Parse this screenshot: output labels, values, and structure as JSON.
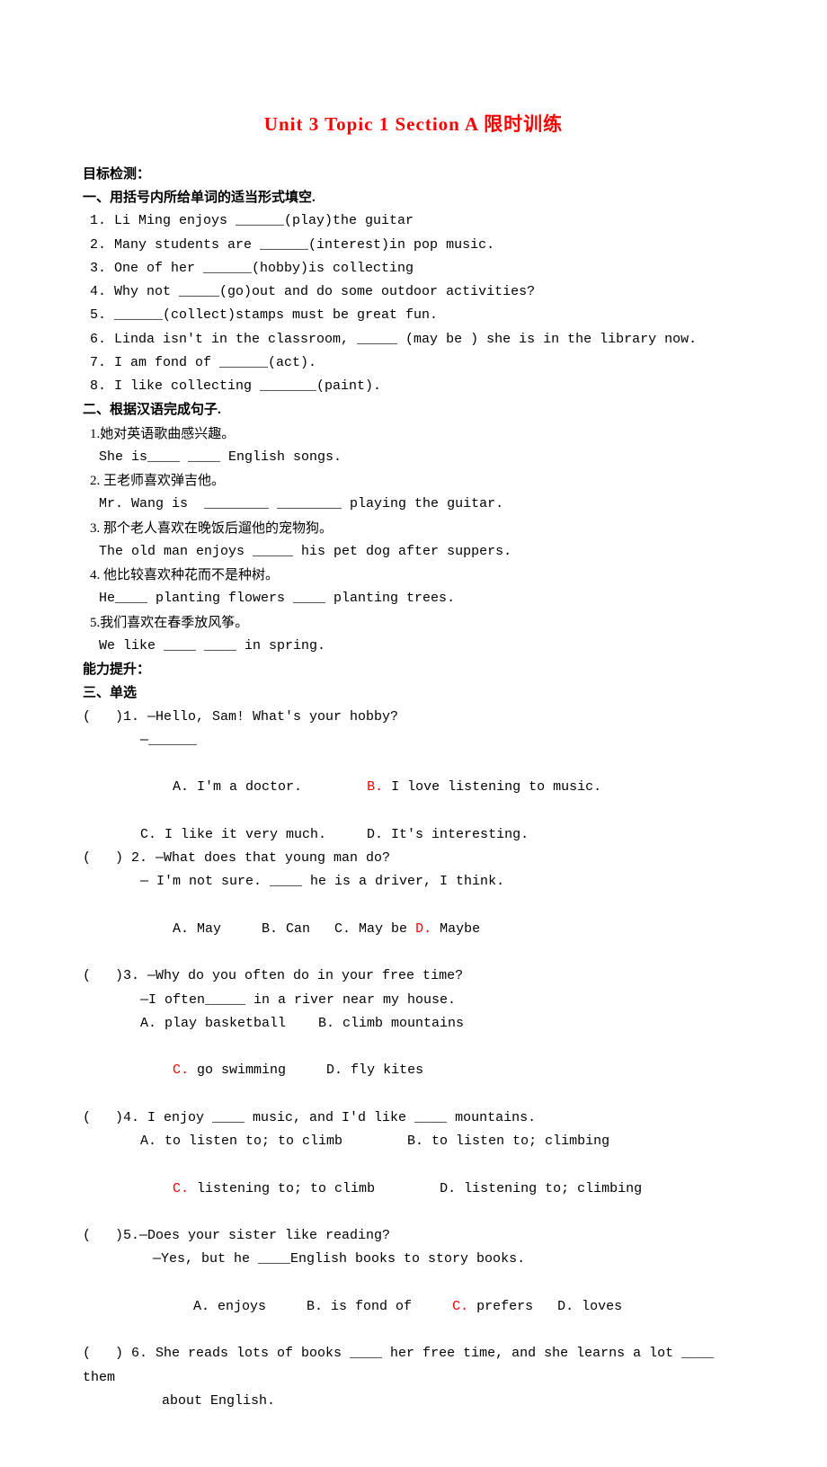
{
  "title": "Unit 3 Topic 1 Section A 限时训练",
  "sec_objective": "目标检测：",
  "sec1_head": "一、用括号内所给单词的适当形式填空.",
  "sec1": {
    "i1": "1. Li Ming enjoys ______(play)the guitar",
    "i2": "2. Many students are ______(interest)in pop music.",
    "i3": "3. One of her ______(hobby)is collecting",
    "i4": "4. Why not _____(go)out and do some outdoor activities?",
    "i5": "5. ______(collect)stamps must be great fun.",
    "i6": "6. Linda isn't in the classroom, _____ (may be ) she is in the library now.",
    "i7": "7. I am fond of ______(act).",
    "i8": "8. I like collecting _______(paint)."
  },
  "sec2_head": "二、根据汉语完成句子.",
  "sec2": {
    "i1a": "1.她对英语歌曲感兴趣。",
    "i1b": "She is____ ____ English songs.",
    "i2a": "2. 王老师喜欢弹吉他。",
    "i2b": "Mr. Wang is  ________ ________ playing the guitar.",
    "i3a": "3. 那个老人喜欢在晚饭后遛他的宠物狗。",
    "i3b": "The old man enjoys _____ his pet dog after suppers.",
    "i4a": "4. 他比较喜欢种花而不是种树。",
    "i4b": "He____ planting flowers ____ planting trees.",
    "i5a": "5.我们喜欢在春季放风筝。",
    "i5b": "We like ____ ____ in spring."
  },
  "sec_ability": "能力提升：",
  "sec3_head": "三、单选",
  "sec3": {
    "q1": {
      "stem": "(   )1. —Hello, Sam! What's your hobby?",
      "stem2": "—______",
      "optA_pre": "A. I'm a doctor.        ",
      "optB_label": "B.",
      "optB_text": " I love listening to music.",
      "optCD": "C. I like it very much.     D. It's interesting."
    },
    "q2": {
      "stem": "(   ) 2. —What does that young man do?",
      "stem2": "— I'm not sure. ____ he is a driver, I think.",
      "optABC": "A. May     B. Can   C. May be ",
      "optD_label": "D.",
      "optD_text": " Maybe"
    },
    "q3": {
      "stem": "(   )3. —Why do you often do in your free time?",
      "stem2": "—I often_____ in a river near my house.",
      "optAB": "A. play basketball    B. climb mountains",
      "optC_label": "C.",
      "optC_text": " go swimming     D. fly kites"
    },
    "q4": {
      "stem": "(   )4. I enjoy ____ music, and I'd like ____ mountains.",
      "optAB": "A. to listen to; to climb        B. to listen to; climbing",
      "optC_label": "C.",
      "optC_text": " listening to; to climb        D. listening to; climbing"
    },
    "q5": {
      "stem": "(   )5.—Does your sister like reading?",
      "stem2": "—Yes, but he ____English books to story books.",
      "optAB": " A. enjoys     B. is fond of     ",
      "optC_label": "C.",
      "optC_text": " prefers   D. loves"
    },
    "q6": {
      "stem": "(   ) 6. She reads lots of books ____ her free time, and she learns a lot ____ them",
      "stem2": "about English."
    }
  }
}
